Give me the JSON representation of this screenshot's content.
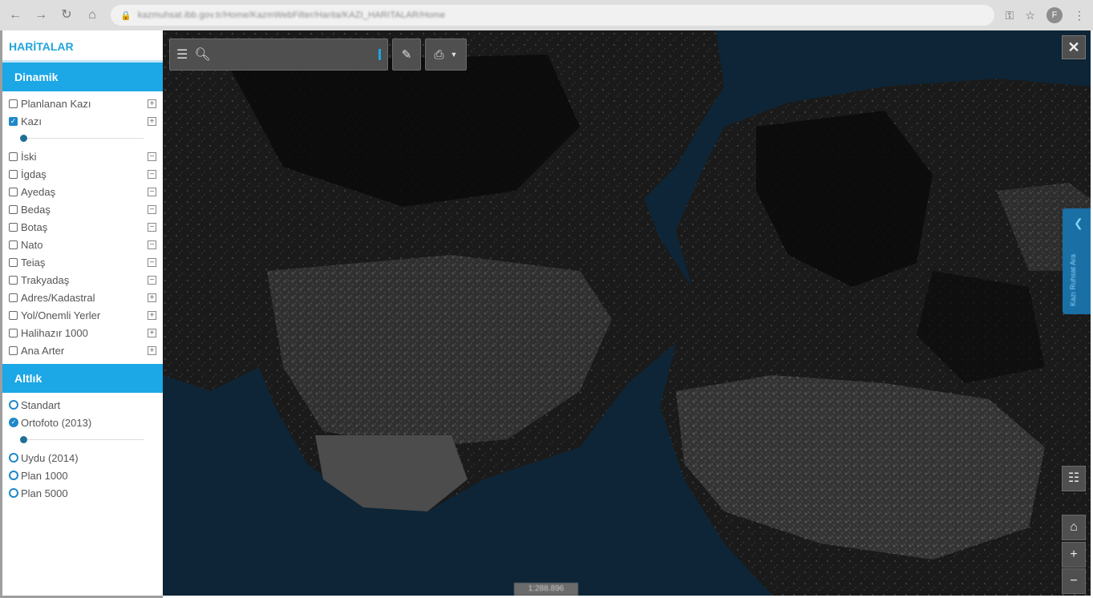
{
  "browser": {
    "url": "kazmuhsat.ibb.gov.tr/Home/KazmWebFilter/Harita/KAZI_HARITALAR/Home"
  },
  "sidebar": {
    "title": "HARİTALAR",
    "dynamic_header": "Dinamik",
    "dynamic_layers": [
      {
        "label": "Planlanan Kazı",
        "checked": false,
        "expander": "⊞"
      },
      {
        "label": "Kazı",
        "checked": true,
        "expander": "⊞"
      },
      {
        "label": "İski",
        "checked": false,
        "expander": "⊟"
      },
      {
        "label": "İgdaş",
        "checked": false,
        "expander": "⊟"
      },
      {
        "label": "Ayedaş",
        "checked": false,
        "expander": "⊟"
      },
      {
        "label": "Bedaş",
        "checked": false,
        "expander": "⊟"
      },
      {
        "label": "Botaş",
        "checked": false,
        "expander": "⊟"
      },
      {
        "label": "Nato",
        "checked": false,
        "expander": "⊟"
      },
      {
        "label": "Teiaş",
        "checked": false,
        "expander": "⊟"
      },
      {
        "label": "Trakyadaş",
        "checked": false,
        "expander": "⊟"
      },
      {
        "label": "Adres/Kadastral",
        "checked": false,
        "expander": "⊞"
      },
      {
        "label": "Yol/Onemli Yerler",
        "checked": false,
        "expander": "⊞"
      },
      {
        "label": "Halihazır 1000",
        "checked": false,
        "expander": "⊞"
      },
      {
        "label": "Ana Arter",
        "checked": false,
        "expander": "⊞"
      }
    ],
    "base_header": "Altlık",
    "base_layers": [
      {
        "label": "Standart",
        "selected": false
      },
      {
        "label": "Ortofoto (2013)",
        "selected": true
      },
      {
        "label": "Uydu (2014)",
        "selected": false
      },
      {
        "label": "Plan 1000",
        "selected": false
      },
      {
        "label": "Plan 5000",
        "selected": false
      }
    ],
    "kazi_opacity": 0.0,
    "ortofoto_opacity": 0.0
  },
  "map": {
    "search_placeholder": "",
    "scale_text": "1:288.896",
    "side_tab_text": "Kazı Ruhsat Ara",
    "icons": {
      "menu": "menu-icon",
      "search": "search-icon",
      "pencil": "pencil-icon",
      "print": "print-icon",
      "close": "close-icon",
      "layers": "layers-list-icon",
      "home": "home-icon",
      "zoom_in": "plus-icon",
      "zoom_out": "minus-icon"
    },
    "colors": {
      "accent": "#1ca7e6",
      "water": "#0c2333",
      "land": "#1c1c1c"
    }
  }
}
